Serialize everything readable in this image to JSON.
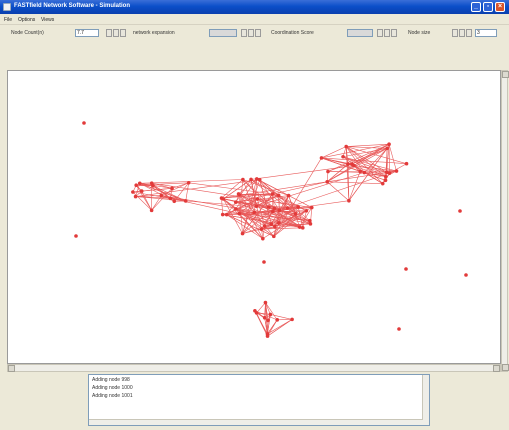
{
  "window": {
    "title": "FASTfield Network Software - Simulation"
  },
  "menu": {
    "items": [
      "File",
      "Options",
      "Views"
    ]
  },
  "toolbar": {
    "node_count_label": "Node Count(n)",
    "node_count_value": "7.7",
    "network_expansion_label": "network expansion",
    "network_expansion_value": "",
    "coordination_score_label": "Coordination Score",
    "coordination_score_value": "",
    "node_size_label": "Node size",
    "node_size_value": "3"
  },
  "log": {
    "lines": [
      "Adding node 998",
      "Adding node 1000",
      "Adding node 1001"
    ]
  },
  "colors": {
    "node": "#e23a3a",
    "edge": "#e85a5a",
    "titlebar": "#0b4fc9"
  }
}
